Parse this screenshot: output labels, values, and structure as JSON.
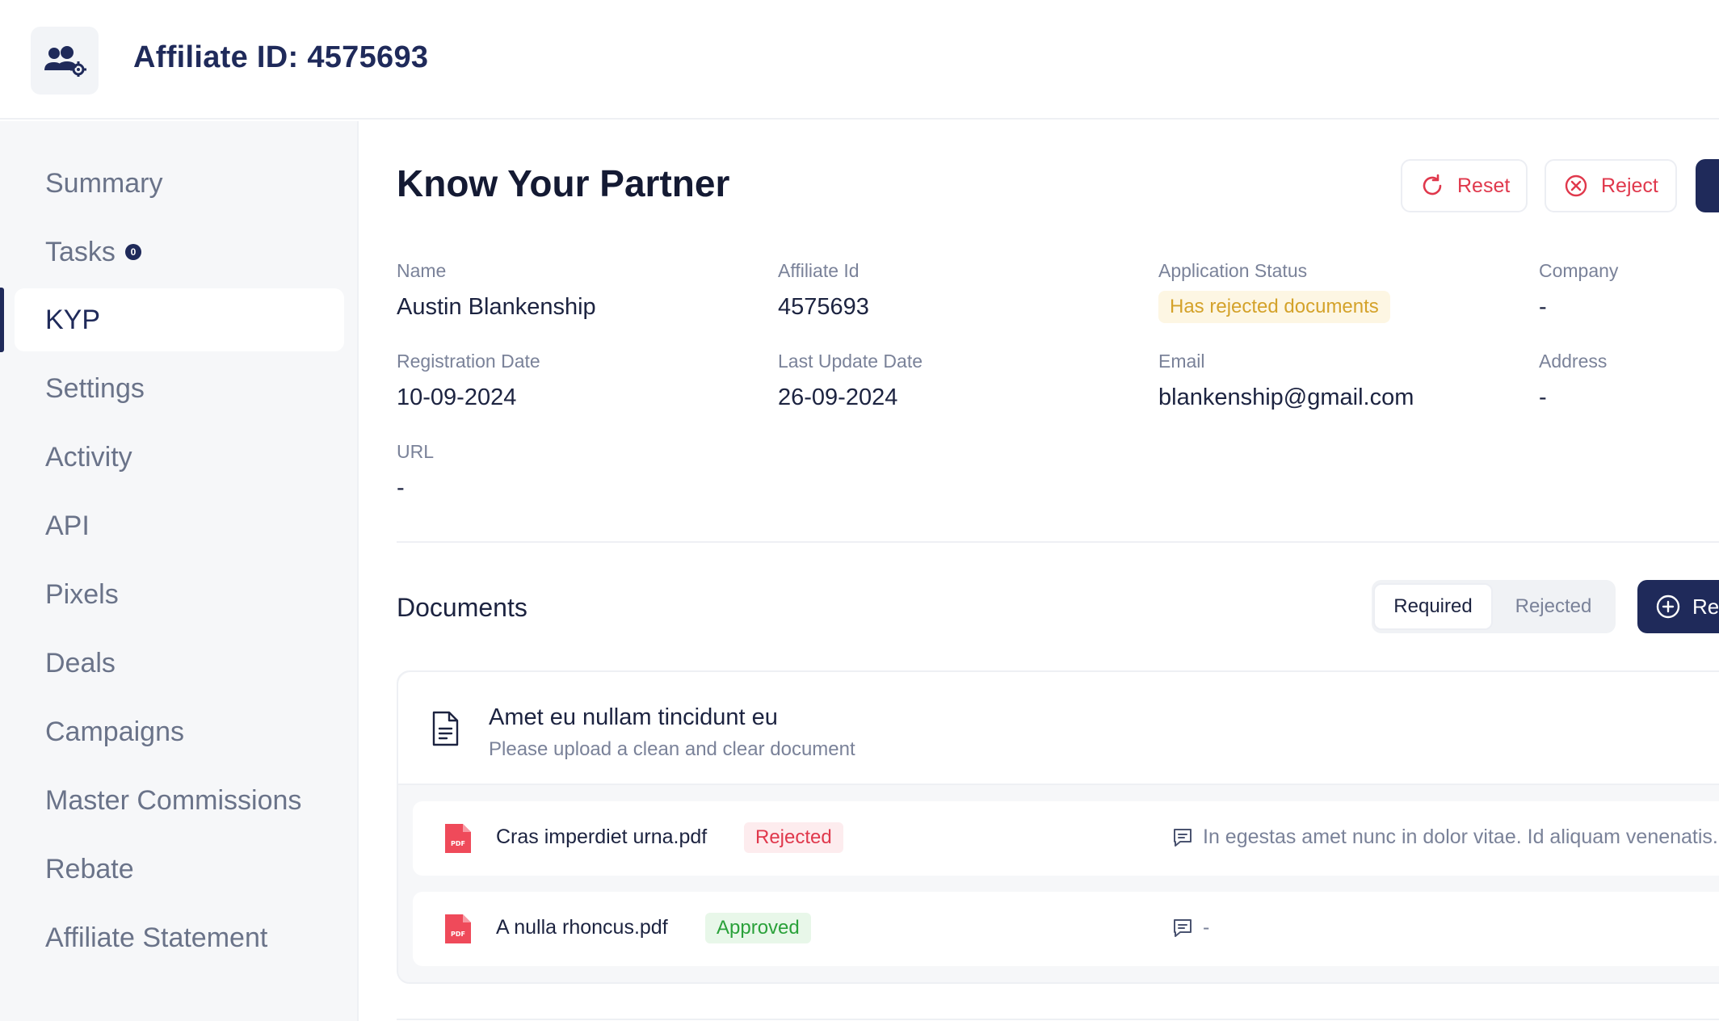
{
  "header": {
    "title": "Affiliate ID: 4575693",
    "logo_icon": "users-gear-icon"
  },
  "sidebar": {
    "items": [
      {
        "label": "Summary"
      },
      {
        "label": "Tasks",
        "badge": "0"
      },
      {
        "label": "KYP",
        "active": true
      },
      {
        "label": "Settings"
      },
      {
        "label": "Activity"
      },
      {
        "label": "API"
      },
      {
        "label": "Pixels"
      },
      {
        "label": "Deals"
      },
      {
        "label": "Campaigns"
      },
      {
        "label": "Master Commissions"
      },
      {
        "label": "Rebate"
      },
      {
        "label": "Affiliate Statement"
      }
    ]
  },
  "main": {
    "title": "Know Your Partner",
    "actions": {
      "reset": "Reset",
      "reject": "Reject"
    },
    "fields": {
      "name_label": "Name",
      "name_value": "Austin Blankenship",
      "affiliate_id_label": "Affiliate Id",
      "affiliate_id_value": "4575693",
      "status_label": "Application Status",
      "status_value": "Has rejected documents",
      "company_label": "Company",
      "company_value": "-",
      "reg_date_label": "Registration Date",
      "reg_date_value": "10-09-2024",
      "last_update_label": "Last Update Date",
      "last_update_value": "26-09-2024",
      "email_label": "Email",
      "email_value": "blankenship@gmail.com",
      "address_label": "Address",
      "address_value": "-",
      "url_label": "URL",
      "url_value": "-"
    },
    "documents": {
      "title": "Documents",
      "filter_required": "Required",
      "filter_rejected": "Rejected",
      "add_label": "Re",
      "card": {
        "title": "Amet eu nullam tincidunt eu",
        "subtitle": "Please upload a clean and clear document",
        "files": [
          {
            "name": "Cras imperdiet urna.pdf",
            "status": "Rejected",
            "comment": "In egestas amet nunc in dolor vitae. Id aliquam venenatis."
          },
          {
            "name": "A nulla rhoncus.pdf",
            "status": "Approved",
            "comment": "-"
          }
        ]
      }
    }
  },
  "colors": {
    "brand": "#1f2a5a",
    "danger": "#e0384c",
    "warning": "#d4a22a",
    "success": "#2aa13a"
  }
}
